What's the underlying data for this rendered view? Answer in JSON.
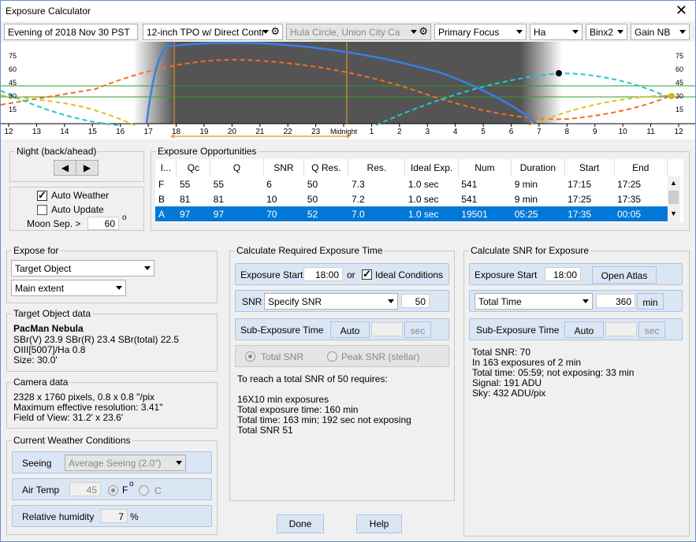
{
  "window": {
    "title": "Exposure Calculator",
    "close": "✕"
  },
  "toolbar": {
    "date": "Evening of 2018 Nov 30 PST",
    "telescope": "12-inch TPO w/ Direct Contr",
    "location": "Hula Circle, Union City Ca",
    "focus": "Primary Focus",
    "filter": "Ha",
    "binning": "Binx2",
    "gain": "Gain NB"
  },
  "chart_data": {
    "type": "line",
    "x_ticks": [
      "12",
      "13",
      "14",
      "15",
      "16",
      "17",
      "18",
      "19",
      "20",
      "21",
      "22",
      "23",
      "Midnight",
      "1",
      "2",
      "3",
      "4",
      "5",
      "6",
      "7",
      "8",
      "9",
      "10",
      "11",
      "12"
    ],
    "y_ticks_left": [
      "75",
      "60",
      "45",
      "30",
      "15"
    ],
    "y_ticks_right": [
      "75",
      "60",
      "45",
      "30",
      "15"
    ]
  },
  "night": {
    "title": "Night (back/ahead)",
    "prev": "◀",
    "next": "▶"
  },
  "options": {
    "auto_weather": "Auto Weather",
    "auto_update": "Auto Update",
    "moon_sep_label": "Moon Sep. >",
    "moon_sep_value": "60",
    "moon_sep_unit": "o"
  },
  "opportunities": {
    "title": "Exposure Opportunities",
    "headers": [
      "I...",
      "Qc",
      "Q",
      "SNR",
      "Q Res.",
      "Res.",
      "Ideal Exp.",
      "Num",
      "Duration",
      "Start",
      "End"
    ],
    "rows": [
      [
        "F",
        "55",
        "55",
        "6",
        "50",
        "7.3",
        "1.0 sec",
        "541",
        "9 min",
        "17:15",
        "17:25"
      ],
      [
        "B",
        "81",
        "81",
        "10",
        "50",
        "7.2",
        "1.0 sec",
        "541",
        "9 min",
        "17:25",
        "17:35"
      ],
      [
        "A",
        "97",
        "97",
        "70",
        "52",
        "7.0",
        "1.0 sec",
        "19501",
        "05:25",
        "17:35",
        "00:05"
      ]
    ]
  },
  "expose_for": {
    "title": "Expose for",
    "target": "Target Object",
    "extent": "Main extent"
  },
  "target_data": {
    "title": "Target Object data",
    "name": "PacMan Nebula",
    "lines": "SBr(V) 23.9 SBr(R) 23.4 SBr(total) 22.5\nOIII[5007]/Ha 0.8\nSize: 30.0'"
  },
  "camera": {
    "title": "Camera data",
    "lines": "2328 x 1760 pixels, 0.8 x 0.8 \"/pix\nMaximum effective resolution: 3.41\"\nField of View: 31.2' x 23.6'"
  },
  "weather": {
    "title": "Current Weather Conditions",
    "seeing_label": "Seeing",
    "seeing_value": "Average Seeing (2.0\")",
    "air_temp_label": "Air Temp",
    "air_temp_value": "45",
    "f_label": "F",
    "f_sup": "o",
    "c_label": "C",
    "humidity_label": "Relative humidity",
    "humidity_value": "7",
    "humidity_unit": "%"
  },
  "calc_exp": {
    "title": "Calculate Required Exposure Time",
    "start_label": "Exposure Start",
    "start_value": "18:00",
    "or": "or",
    "ideal": "Ideal Conditions",
    "snr_label": "SNR",
    "snr_mode": "Specify SNR",
    "snr_value": "50",
    "sub_label": "Sub-Exposure Time",
    "auto": "Auto",
    "sec": "sec",
    "total_snr": "Total SNR",
    "peak_snr": "Peak SNR (stellar)",
    "result": "To reach a total SNR of 50 requires:\n\n16X10 min exposures\nTotal exposure time: 160 min\nTotal time: 163 min; 192 sec not exposing\nTotal SNR 51"
  },
  "calc_snr": {
    "title": "Calculate SNR for Exposure",
    "start_label": "Exposure Start",
    "start_value": "18:00",
    "atlas": "Open Atlas",
    "time_mode": "Total Time",
    "time_value": "360",
    "time_unit": "min",
    "sub_label": "Sub-Exposure Time",
    "auto": "Auto",
    "sec": "sec",
    "result": "Total SNR: 70\nIn 163 exposures of 2 min\nTotal time: 05:59; not exposing: 33 min\nSignal: 191 ADU\nSky: 432 ADU/pix"
  },
  "footer": {
    "done": "Done",
    "help": "Help"
  }
}
